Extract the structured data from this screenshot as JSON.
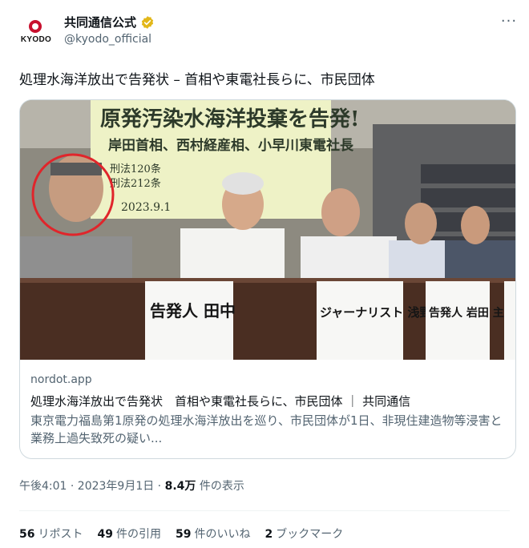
{
  "author": {
    "display_name": "共同通信公式",
    "handle": "@kyodo_official",
    "logo_text": "KYODO",
    "verified_color": "#e2b719"
  },
  "more_icon": "more-horizontal-icon",
  "tweet": {
    "text": "処理水海洋放出で告発状 – 首相や東電社長らに、市民団体"
  },
  "card": {
    "banner_lines": [
      "原発汚染水海洋投棄を告発!",
      "岸田首相、西村経産相、小早川東電社長",
      "刑法120条",
      "刑法212条",
      "2023.9.1"
    ],
    "nameplates": [
      "告発人 田中",
      "ジャーナリスト 浅野健",
      "告発人 岩田 主"
    ],
    "domain": "nordot.app",
    "title": "処理水海洋放出で告発状　首相や東電社長らに、市民団体 ｜ 共同通信",
    "description": "東京電力福島第1原発の処理水海洋放出を巡り、市民団体が1日、非現住建造物等浸害と業務上過失致死の疑い..."
  },
  "meta": {
    "time": "午後4:01 · 2023年9月1日 · ",
    "views": "8.4万",
    "views_label": " 件の表示"
  },
  "stats": [
    {
      "count": "56",
      "label": "リポスト"
    },
    {
      "count": "49",
      "label": "件の引用"
    },
    {
      "count": "59",
      "label": "件のいいね"
    },
    {
      "count": "2",
      "label": "ブックマーク"
    }
  ],
  "colors": {
    "text_primary": "#0f1419",
    "text_secondary": "#536471",
    "border": "#cfd9de",
    "highlight_circle": "#e0252b"
  }
}
